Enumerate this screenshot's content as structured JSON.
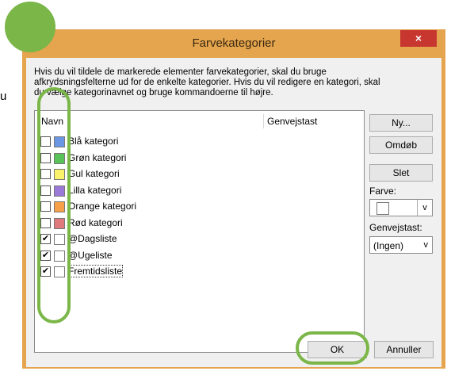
{
  "dialog": {
    "title": "Farvekategorier",
    "close_glyph": "×",
    "description": [
      "Hvis du vil tildele de markerede elementer farvekategorier, skal du bruge",
      "afkrydsningsfelterne ud for de enkelte kategorier. Hvis du vil redigere en kategori, skal",
      "du vælge kategorinavnet og bruge kommandoerne til højre."
    ]
  },
  "list": {
    "col_name": "Navn",
    "col_shortcut": "Genvejstast",
    "items": [
      {
        "label": "Blå kategori",
        "checked": false,
        "color": "#6b96e3"
      },
      {
        "label": "Grøn kategori",
        "checked": false,
        "color": "#59c35a"
      },
      {
        "label": "Gul kategori",
        "checked": false,
        "color": "#f9f26a"
      },
      {
        "label": "Lilla kategori",
        "checked": false,
        "color": "#9b79d8"
      },
      {
        "label": "Orange kategori",
        "checked": false,
        "color": "#f6a14a"
      },
      {
        "label": "Rød kategori",
        "checked": false,
        "color": "#de7a7b"
      },
      {
        "label": "@Dagsliste",
        "checked": true,
        "color": "#ffffff"
      },
      {
        "label": "@Ugeliste",
        "checked": true,
        "color": "#ffffff"
      },
      {
        "label": "Fremtidsliste",
        "checked": true,
        "color": "#ffffff"
      }
    ]
  },
  "buttons": {
    "new": "Ny...",
    "rename": "Omdøb",
    "delete": "Slet",
    "ok": "OK",
    "cancel": "Annuller"
  },
  "side": {
    "color_label": "Farve:",
    "shortcut_label": "Genvejstast:",
    "shortcut_value": "(Ingen)",
    "dropdown_glyph": "v"
  },
  "outer": {
    "fragment": "u"
  },
  "colors": {
    "titlebar": "#e5a44e",
    "highlight": "#7ab648",
    "close": "#c7372f"
  }
}
